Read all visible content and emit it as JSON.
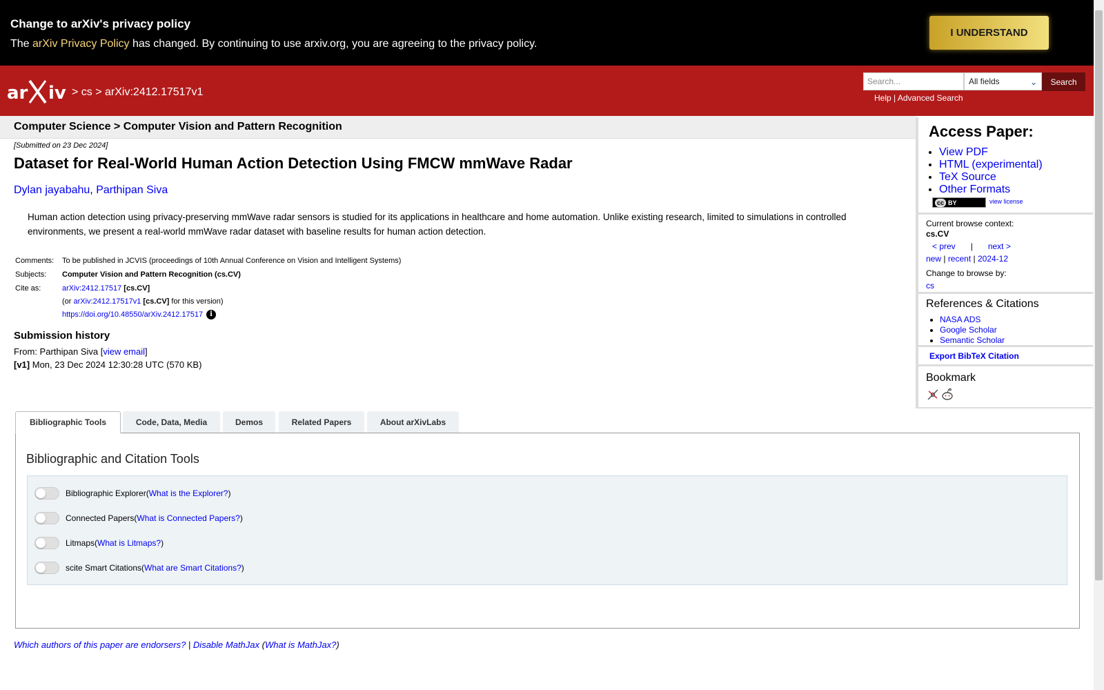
{
  "banner": {
    "title": "Change to arXiv's privacy policy",
    "text_before": "The ",
    "policy_link": "arXiv Privacy Policy",
    "text_after": " has changed. By continuing to use arxiv.org, you are agreeing to the privacy policy.",
    "button": "I UNDERSTAND"
  },
  "header": {
    "logo_alt": "arXiv",
    "crumb_sep1": " > ",
    "crumb_cs": "cs",
    "crumb_sep2": " > ",
    "crumb_id": "arXiv:2412.17517v1",
    "search_placeholder": "Search...",
    "field_select": "All fields",
    "search_button": "Search",
    "help": "Help",
    "separator": " | ",
    "advanced": "Advanced Search"
  },
  "subheader": "Computer Science > Computer Vision and Pattern Recognition",
  "paper": {
    "submitted": "[Submitted on 23 Dec 2024]",
    "title": "Dataset for Real-World Human Action Detection Using FMCW mmWave Radar",
    "authors": [
      "Dylan jayabahu",
      "Parthipan Siva"
    ],
    "author_sep": ", ",
    "abstract": "Human action detection using privacy-preserving mmWave radar sensors is studied for its applications in healthcare and home automation. Unlike existing research, limited to simulations in controlled environments, we present a real-world mmWave radar dataset with baseline results for human action detection.",
    "comments_label": "Comments:",
    "comments": "To be published in JCVIS (proceedings of 10th Annual Conference on Vision and Intelligent Systems)",
    "subjects_label": "Subjects:",
    "subjects": "Computer Vision and Pattern Recognition (cs.CV)",
    "cite_label": "Cite as:",
    "cite_id": "arXiv:2412.17517",
    "cite_cat": " [cs.CV]",
    "cite_or_prefix": "(or ",
    "cite_version_id": "arXiv:2412.17517v1",
    "cite_version_cat": " [cs.CV]",
    "cite_version_suffix": " for this version)",
    "doi": "https://doi.org/10.48550/arXiv.2412.17517",
    "history_title": "Submission history",
    "history_from": "From: Parthipan Siva [",
    "view_email": "view email",
    "history_from_end": "]",
    "v1_label": "[v1]",
    "v1_text": " Mon, 23 Dec 2024 12:30:28 UTC (570 KB)"
  },
  "sidebar": {
    "access_title": "Access Paper:",
    "access_links": [
      "View PDF",
      "HTML (experimental)",
      "TeX Source",
      "Other Formats"
    ],
    "license_badge_cc": "cc",
    "license_badge_by": "BY",
    "view_license": "view license",
    "browse_context_label": "Current browse context:",
    "browse_context": "cs.CV",
    "prev": "< prev",
    "nav_sep": "|",
    "next": "next >",
    "new": "new",
    "recent": "recent",
    "month": "2024-12",
    "change_browse": "Change to browse by:",
    "browse_cs": "cs",
    "refs_title": "References & Citations",
    "refs": [
      "NASA ADS",
      "Google Scholar",
      "Semantic Scholar"
    ],
    "export_bibtex": "Export BibTeX Citation",
    "bookmark_title": "Bookmark"
  },
  "tabs": [
    "Bibliographic Tools",
    "Code, Data, Media",
    "Demos",
    "Related Papers",
    "About arXivLabs"
  ],
  "panel": {
    "title": "Bibliographic and Citation Tools",
    "tools": [
      {
        "name": "Bibliographic Explorer",
        "link": "What is the Explorer?"
      },
      {
        "name": "Connected Papers",
        "link": "What is Connected Papers?"
      },
      {
        "name": "Litmaps",
        "link": "What is Litmaps?"
      },
      {
        "name": "scite Smart Citations",
        "link": "What are Smart Citations?"
      }
    ],
    "paren_open": " (",
    "paren_close": ")"
  },
  "footer": {
    "endorsers": "Which authors of this paper are endorsers?",
    "sep": " | ",
    "disable_mathjax": "Disable MathJax",
    "what_mathjax": "What is MathJax?",
    "paren_open": " (",
    "paren_close": ")"
  },
  "colors": {
    "header_red": "#b31b1b",
    "link_blue": "#0000ee",
    "banner_black": "#000000",
    "button_gold": "#e0c158"
  }
}
